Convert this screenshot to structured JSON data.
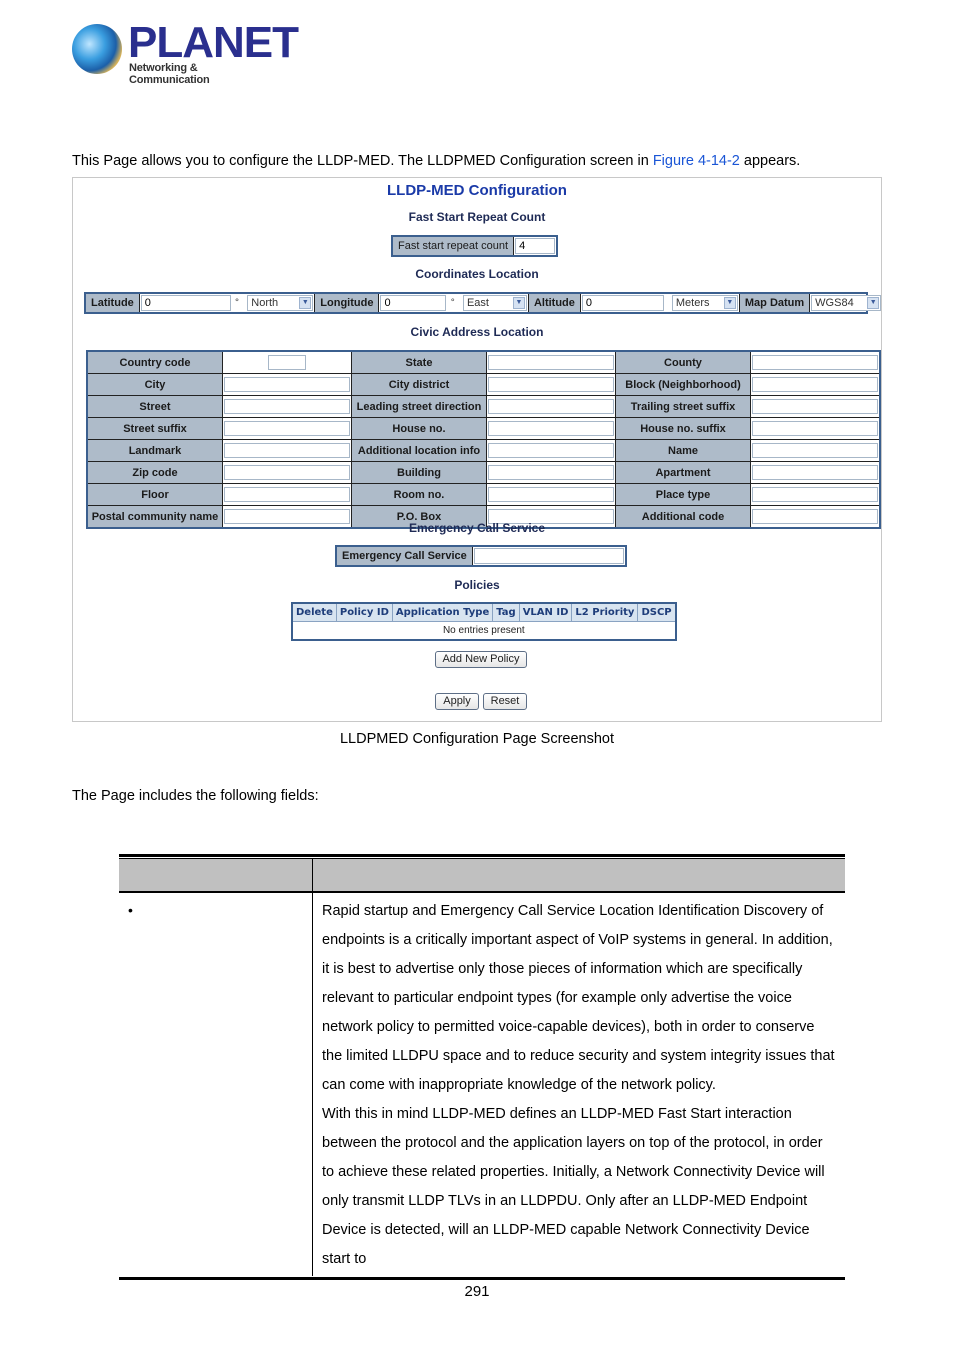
{
  "logo": {
    "brand": "PLANET",
    "tagline": "Networking & Communication"
  },
  "intro": {
    "before": "This Page allows you to configure the LLDP-MED. The LLDPMED Configuration screen in ",
    "link": "Figure 4-14-2",
    "after": " appears."
  },
  "ui": {
    "title": "LLDP-MED Configuration",
    "fast_start": {
      "section": "Fast Start Repeat Count",
      "label": "Fast start repeat count",
      "value": "4"
    },
    "coordinates": {
      "section": "Coordinates Location",
      "latitude_label": "Latitude",
      "latitude_value": "0",
      "latitude_dir": "North",
      "longitude_label": "Longitude",
      "longitude_value": "0",
      "longitude_dir": "East",
      "altitude_label": "Altitude",
      "altitude_value": "0",
      "altitude_unit": "Meters",
      "datum_label": "Map Datum",
      "datum_value": "WGS84",
      "degree_symbol": "°",
      "dropdown_icon": "chevron-down-icon"
    },
    "civic": {
      "section": "Civic Address Location",
      "rows": [
        [
          "Country code",
          "State",
          "County"
        ],
        [
          "City",
          "City district",
          "Block (Neighborhood)"
        ],
        [
          "Street",
          "Leading street direction",
          "Trailing street suffix"
        ],
        [
          "Street suffix",
          "House no.",
          "House no. suffix"
        ],
        [
          "Landmark",
          "Additional location info",
          "Name"
        ],
        [
          "Zip code",
          "Building",
          "Apartment"
        ],
        [
          "Floor",
          "Room no.",
          "Place type"
        ],
        [
          "Postal community name",
          "P.O. Box",
          "Additional code"
        ]
      ]
    },
    "emergency": {
      "section": "Emergency Call Service",
      "label": "Emergency Call Service",
      "value": ""
    },
    "policies": {
      "section": "Policies",
      "columns": [
        "Delete",
        "Policy ID",
        "Application Type",
        "Tag",
        "VLAN ID",
        "L2 Priority",
        "DSCP"
      ],
      "empty_text": "No entries present"
    },
    "buttons": {
      "add_policy": "Add New Policy",
      "apply": "Apply",
      "reset": "Reset"
    }
  },
  "caption": "LLDPMED Configuration Page Screenshot",
  "fields_intro": "The Page includes the following fields:",
  "doc_table": {
    "header": [
      "",
      ""
    ],
    "rows": [
      {
        "bullet": "•",
        "paragraphs": [
          "Rapid startup and Emergency Call Service Location Identification Discovery of endpoints is a critically important aspect of VoIP systems in general. In addition, it is best to advertise only those pieces of information which are specifically relevant to particular endpoint types (for example only advertise the voice network policy to permitted voice-capable devices), both in order to conserve the limited LLDPU space and to reduce security and system integrity issues that can come with inappropriate knowledge of the network policy.",
          "With this in mind LLDP-MED defines an LLDP-MED Fast Start interaction between the protocol and the application layers on top of the protocol, in order to achieve these related properties. Initially, a Network Connectivity Device will only transmit LLDP TLVs in an LLDPDU. Only after an LLDP-MED Endpoint Device is detected, will an LLDP-MED capable Network Connectivity Device start to"
        ]
      }
    ]
  },
  "page_number": "291"
}
